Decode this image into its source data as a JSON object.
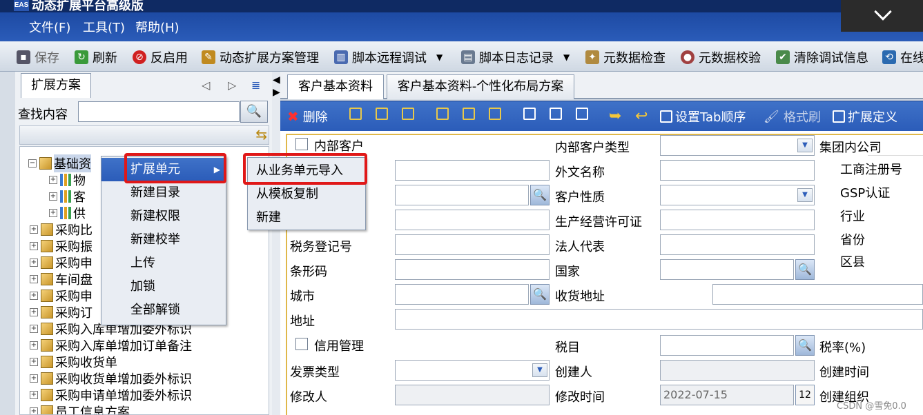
{
  "window": {
    "logo": "EAS",
    "title": "动态扩展平台高级版"
  },
  "menu": [
    "文件(F)",
    "工具(T)",
    "帮助(H)"
  ],
  "toolbar": {
    "save": "保存",
    "refresh": "刷新",
    "reenable": "反启用",
    "scheme_mgmt": "动态扩展方案管理",
    "remote_debug": "脚本远程调试",
    "script_log": "脚本日志记录",
    "meta_check": "元数据检查",
    "meta_verify": "元数据校验",
    "clear_debug": "清除调试信息",
    "online": "在线"
  },
  "left": {
    "tab": "扩展方案",
    "search_label": "查找内容",
    "search_value": "",
    "tree": [
      {
        "label": "基础资",
        "level": 0,
        "type": "folder",
        "expanded": true
      },
      {
        "label": "物",
        "level": 1,
        "type": "chart"
      },
      {
        "label": "客",
        "level": 1,
        "type": "chart"
      },
      {
        "label": "供",
        "level": 1,
        "type": "chart"
      },
      {
        "label": "采购比",
        "level": 0,
        "type": "folder"
      },
      {
        "label": "采购振",
        "level": 0,
        "type": "folder"
      },
      {
        "label": "采购申",
        "level": 0,
        "type": "folder"
      },
      {
        "label": "车间盘",
        "level": 0,
        "type": "folder"
      },
      {
        "label": "采购申",
        "level": 0,
        "type": "folder"
      },
      {
        "label": "采购订",
        "level": 0,
        "type": "folder"
      },
      {
        "label": "采购入库单增加委外标识",
        "level": 0,
        "type": "folder"
      },
      {
        "label": "采购入库单增加订单备注",
        "level": 0,
        "type": "folder"
      },
      {
        "label": "采购收货单",
        "level": 0,
        "type": "folder"
      },
      {
        "label": "采购收货单增加委外标识",
        "level": 0,
        "type": "folder"
      },
      {
        "label": "采购申请单增加委外标识",
        "level": 0,
        "type": "folder"
      },
      {
        "label": "员工信息方案",
        "level": 0,
        "type": "folder"
      }
    ]
  },
  "context_menu": {
    "items": [
      "扩展单元",
      "新建目录",
      "新建权限",
      "新建校举",
      "上传",
      "加锁",
      "全部解锁"
    ],
    "submenu": [
      "从业务单元导入",
      "从模板复制",
      "新建"
    ]
  },
  "right": {
    "tabs": [
      "客户基本资料",
      "客户基本资料-个性化布局方案"
    ],
    "toolbar": {
      "delete": "删除",
      "tab_order": "设置Tab顺序",
      "format_brush": "格式刷",
      "ext_def": "扩展定义"
    },
    "form": {
      "internal_customer": "内部客户",
      "internal_customer_type": "内部客户类型",
      "group_company": "集团内公司",
      "foreign_name": "外文名称",
      "business_reg": "工商注册号",
      "customer_nature": "客户性质",
      "gsp": "GSP认证",
      "production_license": "生产经营许可证",
      "industry": "行业",
      "tax_reg": "税务登记号",
      "legal_rep": "法人代表",
      "province": "省份",
      "barcode": "条形码",
      "country": "国家",
      "district": "区县",
      "city": "城市",
      "ship_addr": "收货地址",
      "address": "地址",
      "credit_mgmt": "信用管理",
      "tax_item": "税目",
      "tax_rate": "税率(%)",
      "invoice_type": "发票类型",
      "creator": "创建人",
      "create_time": "创建时间",
      "modifier": "修改人",
      "modify_time": "修改时间",
      "modify_time_value": "2022-07-15",
      "create_org": "创建组织"
    }
  },
  "watermark": "CSDN @雪免0.0"
}
